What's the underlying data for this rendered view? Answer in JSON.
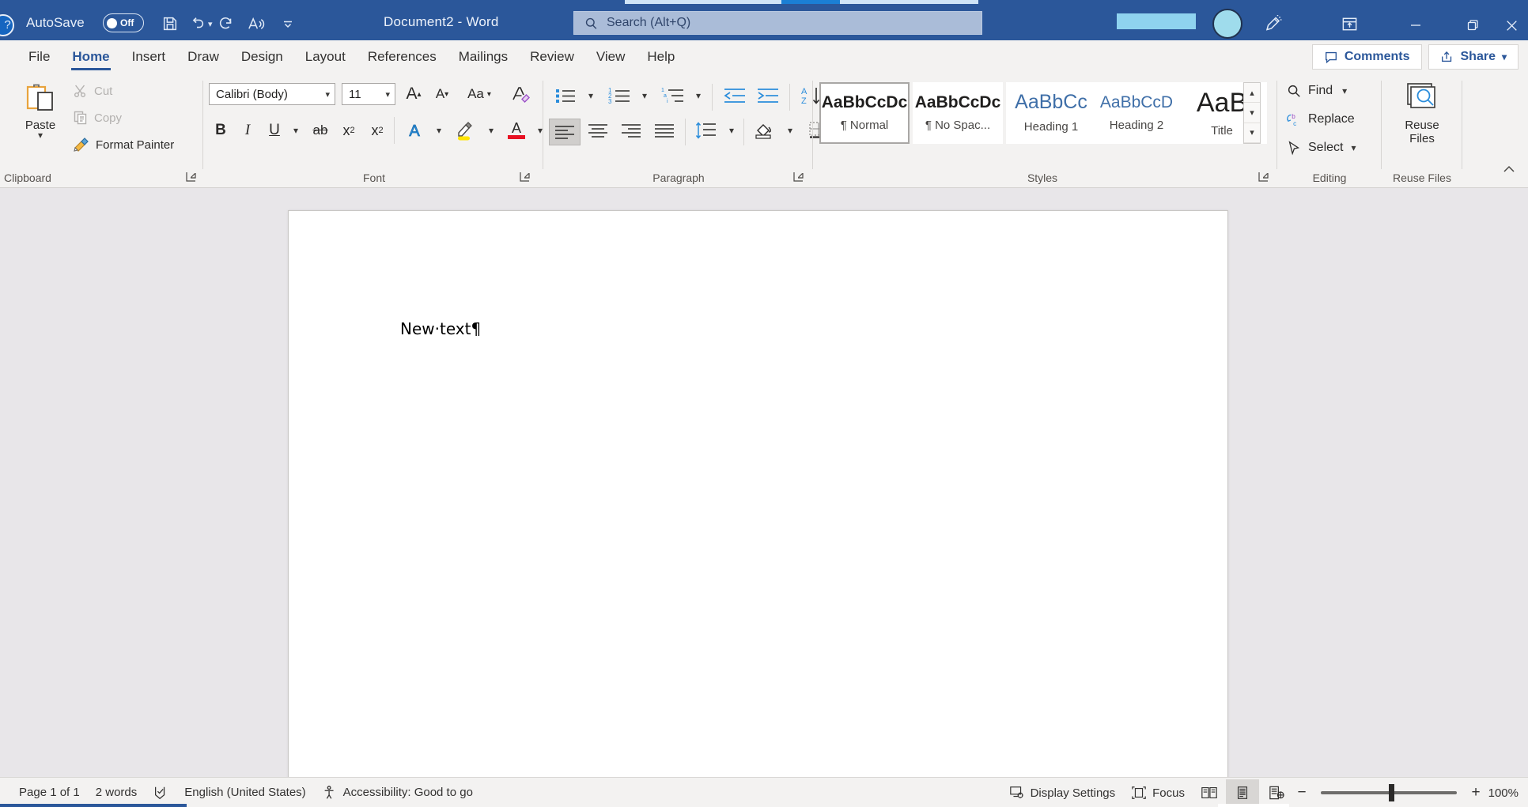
{
  "titlebar": {
    "help_icon": "help-circle-icon",
    "autosave_label": "AutoSave",
    "autosave_state": "Off",
    "save_icon": "save-icon",
    "undo_icon": "undo-icon",
    "redo_icon": "redo-icon",
    "read_aloud_icon": "read-aloud-icon",
    "customize_qat_icon": "chevron-down-icon",
    "document_title": "Document2  -  Word",
    "search_placeholder": "Search (Alt+Q)",
    "search_icon": "search-icon",
    "avatar_icon": "account-avatar",
    "ink_icon": "ink-pen-icon",
    "ribbon_display_icon": "ribbon-display-options-icon",
    "minimize_icon": "minimize-icon",
    "restore_icon": "restore-icon",
    "close_icon": "close-icon",
    "accent_color": "#2b579a"
  },
  "tabs": [
    {
      "label": "File",
      "active": false
    },
    {
      "label": "Home",
      "active": true
    },
    {
      "label": "Insert",
      "active": false
    },
    {
      "label": "Draw",
      "active": false
    },
    {
      "label": "Design",
      "active": false
    },
    {
      "label": "Layout",
      "active": false
    },
    {
      "label": "References",
      "active": false
    },
    {
      "label": "Mailings",
      "active": false
    },
    {
      "label": "Review",
      "active": false
    },
    {
      "label": "View",
      "active": false
    },
    {
      "label": "Help",
      "active": false
    }
  ],
  "ribbon_right": {
    "comments_label": "Comments",
    "comments_icon": "comment-icon",
    "share_label": "Share",
    "share_icon": "share-icon",
    "share_chevron": "chevron-down-icon",
    "collapse_icon": "chevron-up-icon"
  },
  "clipboard": {
    "group_label": "Clipboard",
    "paste_label": "Paste",
    "paste_icon": "paste-clipboard-icon",
    "paste_chevron": "chevron-down-icon",
    "cut_label": "Cut",
    "cut_icon": "scissors-icon",
    "copy_label": "Copy",
    "copy_icon": "copy-icon",
    "format_painter_label": "Format Painter",
    "format_painter_icon": "paintbrush-icon",
    "launcher_icon": "dialog-launcher-icon"
  },
  "font": {
    "group_label": "Font",
    "font_family_value": "Calibri (Body)",
    "font_size_value": "11",
    "grow_font_icon": "grow-font-icon",
    "shrink_font_icon": "shrink-font-icon",
    "change_case_icon": "change-case-icon",
    "clear_formatting_icon": "clear-formatting-icon",
    "bold_label": "B",
    "italic_label": "I",
    "underline_label": "U",
    "strikethrough_label": "ab",
    "subscript_label": "x",
    "superscript_label": "x",
    "text_effects_icon": "text-effects-icon",
    "highlight_icon": "text-highlight-icon",
    "font_color_icon": "font-color-icon",
    "highlight_color": "#ffe400",
    "font_color": "#e81123",
    "launcher_icon": "dialog-launcher-icon"
  },
  "paragraph": {
    "group_label": "Paragraph",
    "bullets_icon": "bullet-list-icon",
    "numbering_icon": "numbered-list-icon",
    "multilevel_icon": "multilevel-list-icon",
    "decrease_indent_icon": "decrease-indent-icon",
    "increase_indent_icon": "increase-indent-icon",
    "sort_icon": "sort-az-icon",
    "show_marks_icon": "show-formatting-marks-icon",
    "show_marks_active": true,
    "align_left_icon": "align-left-icon",
    "align_left_active": true,
    "align_center_icon": "align-center-icon",
    "align_right_icon": "align-right-icon",
    "justify_icon": "justify-icon",
    "line_spacing_icon": "line-spacing-icon",
    "shading_icon": "shading-icon",
    "borders_icon": "borders-icon",
    "launcher_icon": "dialog-launcher-icon"
  },
  "styles": {
    "group_label": "Styles",
    "items": [
      {
        "sample": "AaBbCcDc",
        "name": "¶ Normal",
        "selected": true,
        "kind": "body"
      },
      {
        "sample": "AaBbCcDc",
        "name": "¶ No Spac...",
        "selected": false,
        "kind": "body"
      },
      {
        "sample": "AaBbCc",
        "name": "Heading 1",
        "selected": false,
        "kind": "heading"
      },
      {
        "sample": "AaBbCcD",
        "name": "Heading 2",
        "selected": false,
        "kind": "heading"
      },
      {
        "sample": "AaB",
        "name": "Title",
        "selected": false,
        "kind": "title"
      }
    ],
    "scroll_up_icon": "chevron-up-icon",
    "scroll_down_icon": "chevron-down-icon",
    "more_icon": "more-styles-icon",
    "launcher_icon": "dialog-launcher-icon"
  },
  "editing": {
    "group_label": "Editing",
    "find_label": "Find",
    "find_icon": "search-icon",
    "find_chevron": "chevron-down-icon",
    "replace_label": "Replace",
    "replace_icon": "replace-icon",
    "select_label": "Select",
    "select_icon": "cursor-arrow-icon",
    "select_chevron": "chevron-down-icon"
  },
  "reuse": {
    "group_label": "Reuse Files",
    "button_line1": "Reuse",
    "button_line2": "Files",
    "icon": "reuse-files-icon"
  },
  "document": {
    "body_text": "New·text¶"
  },
  "statusbar": {
    "page_label": "Page 1 of 1",
    "words_label": "2 words",
    "proofing_icon": "proofing-errors-icon",
    "language_label": "English (United States)",
    "accessibility_icon": "accessibility-icon",
    "accessibility_label": "Accessibility: Good to go",
    "display_settings_icon": "display-settings-icon",
    "display_settings_label": "Display Settings",
    "focus_icon": "focus-icon",
    "focus_label": "Focus",
    "read_mode_icon": "read-mode-icon",
    "print_layout_icon": "print-layout-icon",
    "web_layout_icon": "web-layout-icon",
    "active_view": "print-layout-icon",
    "zoom_out_label": "−",
    "zoom_in_label": "+",
    "zoom_level": "100%"
  }
}
